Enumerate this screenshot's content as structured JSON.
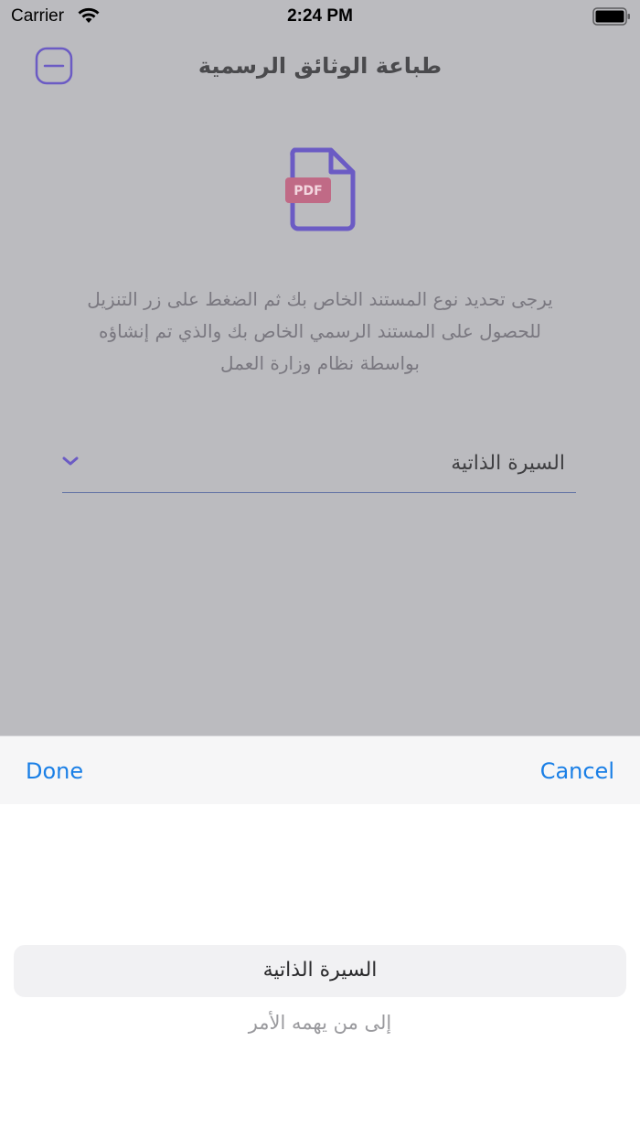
{
  "status_bar": {
    "carrier": "Carrier",
    "time": "2:24 PM"
  },
  "nav": {
    "title": "طباعة الوثائق الرسمية",
    "close_icon": "minus-circle-icon"
  },
  "pdf_icon": {
    "label": "PDF",
    "accent_color": "#6b5bc4",
    "badge_color": "#c06a86"
  },
  "instructions": "يرجى تحديد نوع المستند الخاص بك ثم الضغط على زر التنزيل للحصول على المستند الرسمي الخاص بك والذي تم إنشاؤه بواسطة نظام وزارة العمل",
  "dropdown": {
    "selected_value": "السيرة الذاتية"
  },
  "picker": {
    "done_label": "Done",
    "cancel_label": "Cancel",
    "options": [
      "السيرة الذاتية",
      "إلى من يهمه الأمر"
    ],
    "selected_index": 0,
    "tint_color": "#1a7fe6"
  }
}
